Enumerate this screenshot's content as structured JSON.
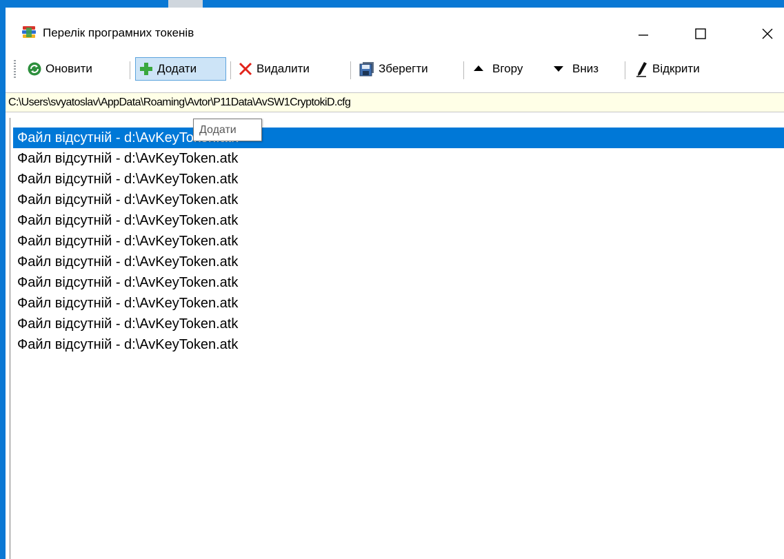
{
  "window": {
    "title": "Перелік програмних токенів"
  },
  "toolbar": {
    "refresh_label": "Оновити",
    "add_label": "Додати",
    "delete_label": "Видалити",
    "save_label": "Зберегти",
    "up_label": "Вгору",
    "down_label": "Вниз",
    "open_label": "Відкрити"
  },
  "path": "C:\\Users\\svyatoslav\\AppData\\Roaming\\Avtor\\P11Data\\AvSW1CryptokiD.cfg",
  "list": {
    "items": [
      "Файл відсутній - d:\\AvKeyToken.atk",
      "Файл відсутній - d:\\AvKeyToken.atk",
      "Файл відсутній - d:\\AvKeyToken.atk",
      "Файл відсутній - d:\\AvKeyToken.atk",
      "Файл відсутній - d:\\AvKeyToken.atk",
      "Файл відсутній - d:\\AvKeyToken.atk",
      "Файл відсутній - d:\\AvKeyToken.atk",
      "Файл відсутній - d:\\AvKeyToken.atk",
      "Файл відсутній - d:\\AvKeyToken.atk",
      "Файл відсутній - d:\\AvKeyToken.atk",
      "Файл відсутній - d:\\AvKeyToken.atk"
    ],
    "selected_index": 0
  },
  "tooltip": {
    "text": "Додати"
  },
  "colors": {
    "selection": "#0078d7",
    "path_background": "#ffffe7",
    "active_button": "#cde4f7",
    "desktop_accent": "#0a78d4"
  }
}
